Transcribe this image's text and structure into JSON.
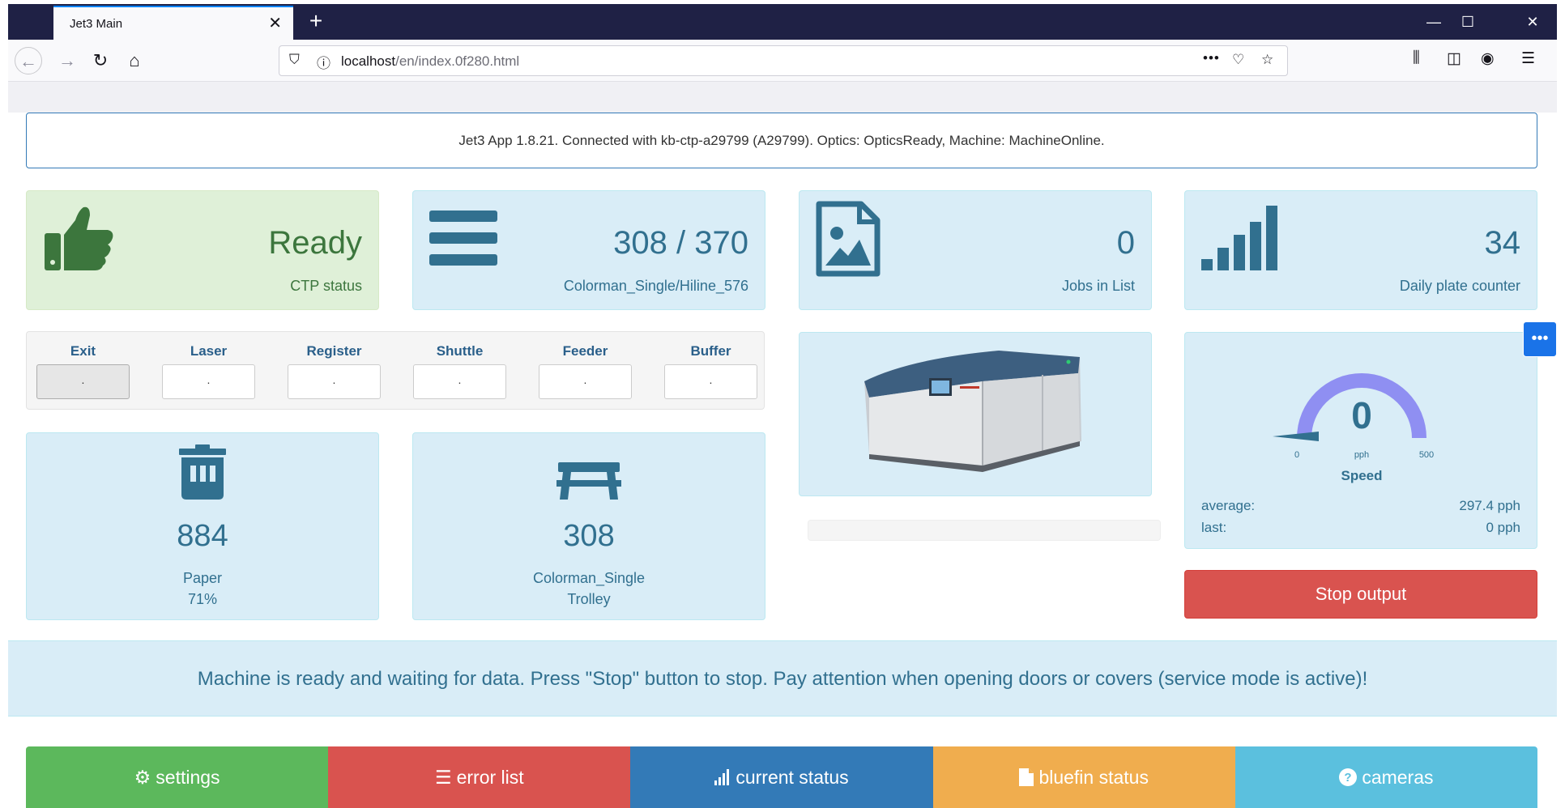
{
  "browser": {
    "tab_title": "Jet3 Main",
    "url_host": "localhost",
    "url_path": "/en/index.0f280.html"
  },
  "app": {
    "info_text": "Jet3 App 1.8.21. Connected with kb-ctp-a29799 (A29799). Optics: OpticsReady, Machine: MachineOnline.",
    "ctp_status": {
      "value": "Ready",
      "label": "CTP status"
    },
    "plates": {
      "value": "308 / 370",
      "label": "Colorman_Single/Hiline_576"
    },
    "jobs": {
      "value": "0",
      "label": "Jobs in List"
    },
    "daily": {
      "value": "34",
      "label": "Daily plate counter"
    },
    "stations": [
      {
        "name": "Exit",
        "value": "."
      },
      {
        "name": "Laser",
        "value": "."
      },
      {
        "name": "Register",
        "value": "."
      },
      {
        "name": "Shuttle",
        "value": "."
      },
      {
        "name": "Feeder",
        "value": "."
      },
      {
        "name": "Buffer",
        "value": "."
      }
    ],
    "paper": {
      "value": "884",
      "label": "Paper",
      "percent": "71%"
    },
    "trolley": {
      "value": "308",
      "label": "Colorman_Single",
      "label2": "Trolley"
    },
    "progress": 0,
    "speed": {
      "value": "0",
      "unit": "pph",
      "min": "0",
      "max": "500",
      "title": "Speed",
      "average_label": "average:",
      "average_value": "297.4 pph",
      "last_label": "last:",
      "last_value": "0 pph"
    },
    "stop_button": "Stop output",
    "message": "Machine is ready and waiting for data. Press \"Stop\" button to stop. Pay attention when opening doors or covers (service mode is active)!",
    "footer": {
      "settings": "settings",
      "error_list": "error list",
      "current_status": "current status",
      "bluefin_status": "bluefin status",
      "cameras": "cameras"
    }
  },
  "colors": {
    "info_panel": "#d9edf7",
    "success_panel": "#dff0d8",
    "danger": "#d9534f",
    "primary": "#337ab7",
    "success": "#5cb85c",
    "warning": "#f0ad4e",
    "info": "#5bc0de",
    "gauge": "#8f8ff2"
  }
}
